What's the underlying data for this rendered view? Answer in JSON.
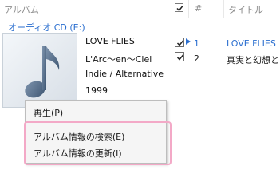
{
  "header": {
    "album_col": "アルバム",
    "number_col": "#",
    "title_col": "タイトル"
  },
  "group_label": "オーディオ CD (E:)",
  "album": {
    "title": "LOVE FLIES",
    "artist": "L'Arc〜en〜Ciel",
    "genre": "Indie / Alternative",
    "year": "1999"
  },
  "tracks": [
    {
      "number": "1",
      "title": "LOVE FLIES",
      "checked": true,
      "playing": true
    },
    {
      "number": "2",
      "title": "真実と幻想と",
      "checked": true,
      "playing": false
    }
  ],
  "context_menu": {
    "items": [
      {
        "label": "再生(P)"
      },
      {
        "label": "アルバム情報の検索(E)"
      },
      {
        "label": "アルバム情報の更新(I)"
      }
    ]
  },
  "colors": {
    "accent": "#2a6ecf",
    "highlight_border": "#f3a9c7",
    "header_text": "#8c8c8c"
  }
}
